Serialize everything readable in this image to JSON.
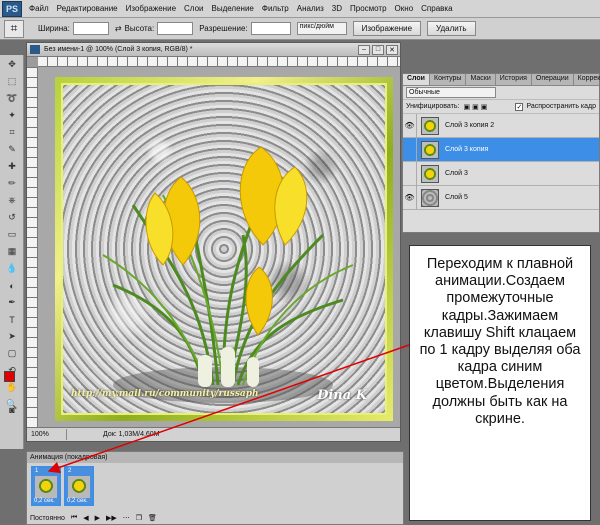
{
  "menubar": {
    "logo": "PS",
    "items": [
      "Файл",
      "Редактирование",
      "Изображение",
      "Слои",
      "Выделение",
      "Фильтр",
      "Анализ",
      "3D",
      "Просмотр",
      "Окно",
      "Справка"
    ]
  },
  "options": {
    "width_label": "Ширина:",
    "height_label": "Высота:",
    "resolution_label": "Разрешение:",
    "units": "пикс/дюйм",
    "image_button": "Изображение",
    "delete_button": "Удалить"
  },
  "document": {
    "title": "Без имени-1 @ 100% (Слой 3 копия, RGB/8) *",
    "watermark": "http://my.mail.ru/community/russaph",
    "signature": "Dina K",
    "zoom": "100%",
    "doc_size": "Док: 1,03M/4,60M"
  },
  "layers_panel": {
    "tabs": [
      "Слои",
      "Контуры",
      "Маски",
      "История",
      "Операции",
      "Коррекция"
    ],
    "blend_mode": "Обычные",
    "unify_label": "Унифицировать:",
    "spread_label": "Распространить кадр",
    "layers": [
      {
        "name": "Слой 3 копия 2",
        "visible": true,
        "selected": false
      },
      {
        "name": "Слой 3 копия",
        "visible": false,
        "selected": true
      },
      {
        "name": "Слой 3",
        "visible": false,
        "selected": false
      },
      {
        "name": "Слой 5",
        "visible": true,
        "selected": false
      }
    ]
  },
  "animation": {
    "title": "Анимация (покадровая)",
    "frames": [
      {
        "num": "1",
        "delay": "0,2 сек."
      },
      {
        "num": "2",
        "delay": "0,2 сек."
      }
    ],
    "loop": "Постоянно"
  },
  "callout": {
    "text": "Переходим к плавной анимации.Создаем промежуточные кадры.Зажимаем клавишу Shift клацаем по 1 кадру выделяя оба кадра синим цветом.Выделения должны быть как на скрине."
  },
  "colors": {
    "accent": "#3d8ee6",
    "foreground": "#e00000",
    "background": "#ffffff",
    "arrow": "#e00000"
  }
}
